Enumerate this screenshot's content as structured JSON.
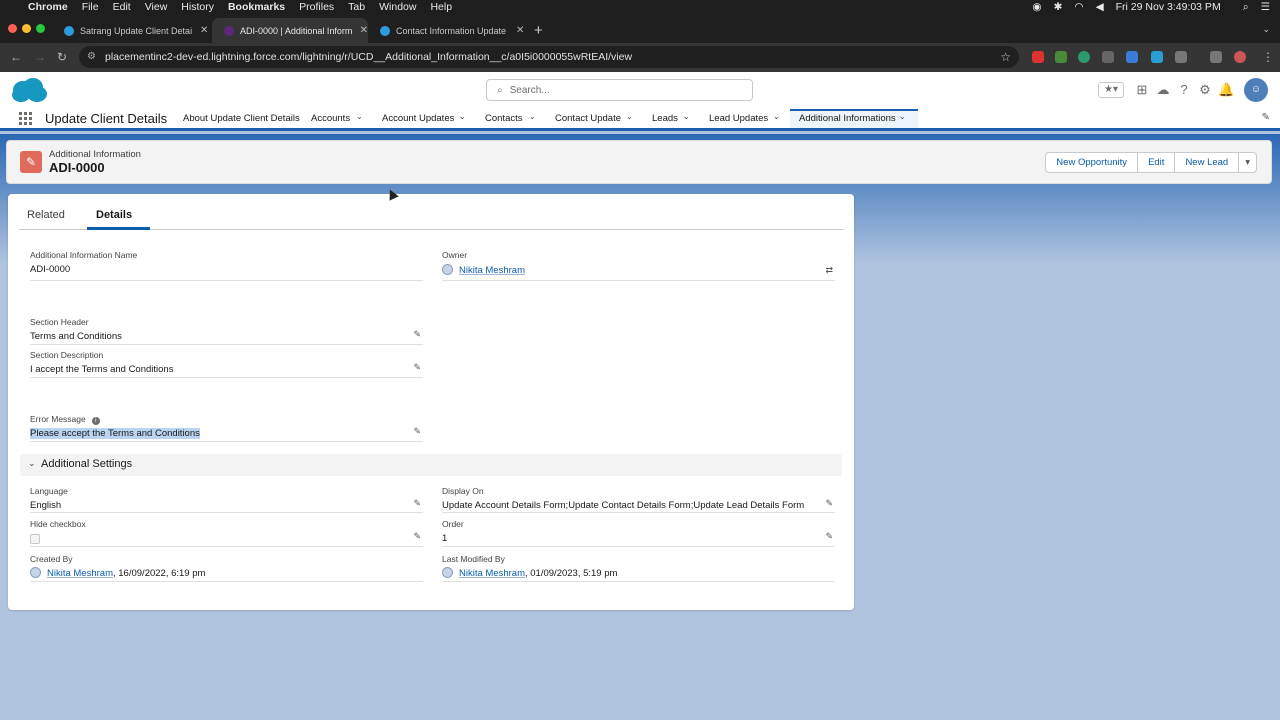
{
  "macbar": {
    "app": "Chrome",
    "menus": [
      "File",
      "Edit",
      "View",
      "History",
      "Bookmarks",
      "Profiles",
      "Tab",
      "Window",
      "Help"
    ],
    "clock": "Fri 29 Nov  3:49:03 PM"
  },
  "browser": {
    "tabs": [
      {
        "title": "Satrang Update Client Details"
      },
      {
        "title": "ADI-0000 | Additional Inform..."
      },
      {
        "title": "Contact Information Update F..."
      }
    ],
    "url": "placementinc2-dev-ed.lightning.force.com/lightning/r/UCD__Additional_Information__c/a0I5i0000055wRtEAI/view"
  },
  "sf": {
    "search_placeholder": "Search...",
    "app_name": "Update Client Details",
    "nav": [
      {
        "label": "About Update Client Details"
      },
      {
        "label": "Accounts"
      },
      {
        "label": "Account Updates"
      },
      {
        "label": "Contacts"
      },
      {
        "label": "Contact Update"
      },
      {
        "label": "Leads"
      },
      {
        "label": "Lead Updates"
      },
      {
        "label": "Additional Informations"
      }
    ]
  },
  "record": {
    "object_label": "Additional Information",
    "name": "ADI-0000",
    "actions": [
      "New Opportunity",
      "Edit",
      "New Lead"
    ]
  },
  "tabs": {
    "related": "Related",
    "details": "Details"
  },
  "fields": {
    "name_label": "Additional Information Name",
    "name_value": "ADI-0000",
    "owner_label": "Owner",
    "owner_value": "Nikita Meshram",
    "section_header_label": "Section Header",
    "section_header_value": "Terms and Conditions",
    "section_desc_label": "Section Description",
    "section_desc_value": "I accept the Terms and Conditions",
    "error_label": "Error Message",
    "error_value": "Please accept the Terms and Conditions"
  },
  "additional_settings": {
    "title": "Additional Settings",
    "language_label": "Language",
    "language_value": "English",
    "display_on_label": "Display On",
    "display_on_value": "Update Account Details Form;Update Contact Details Form;Update Lead Details Form",
    "hide_checkbox_label": "Hide checkbox",
    "order_label": "Order",
    "order_value": "1",
    "created_by_label": "Created By",
    "created_by_user": "Nikita Meshram",
    "created_by_date": ", 16/09/2022, 6:19 pm",
    "modified_by_label": "Last Modified By",
    "modified_by_user": "Nikita Meshram",
    "modified_by_date": ", 01/09/2023, 5:19 pm"
  }
}
